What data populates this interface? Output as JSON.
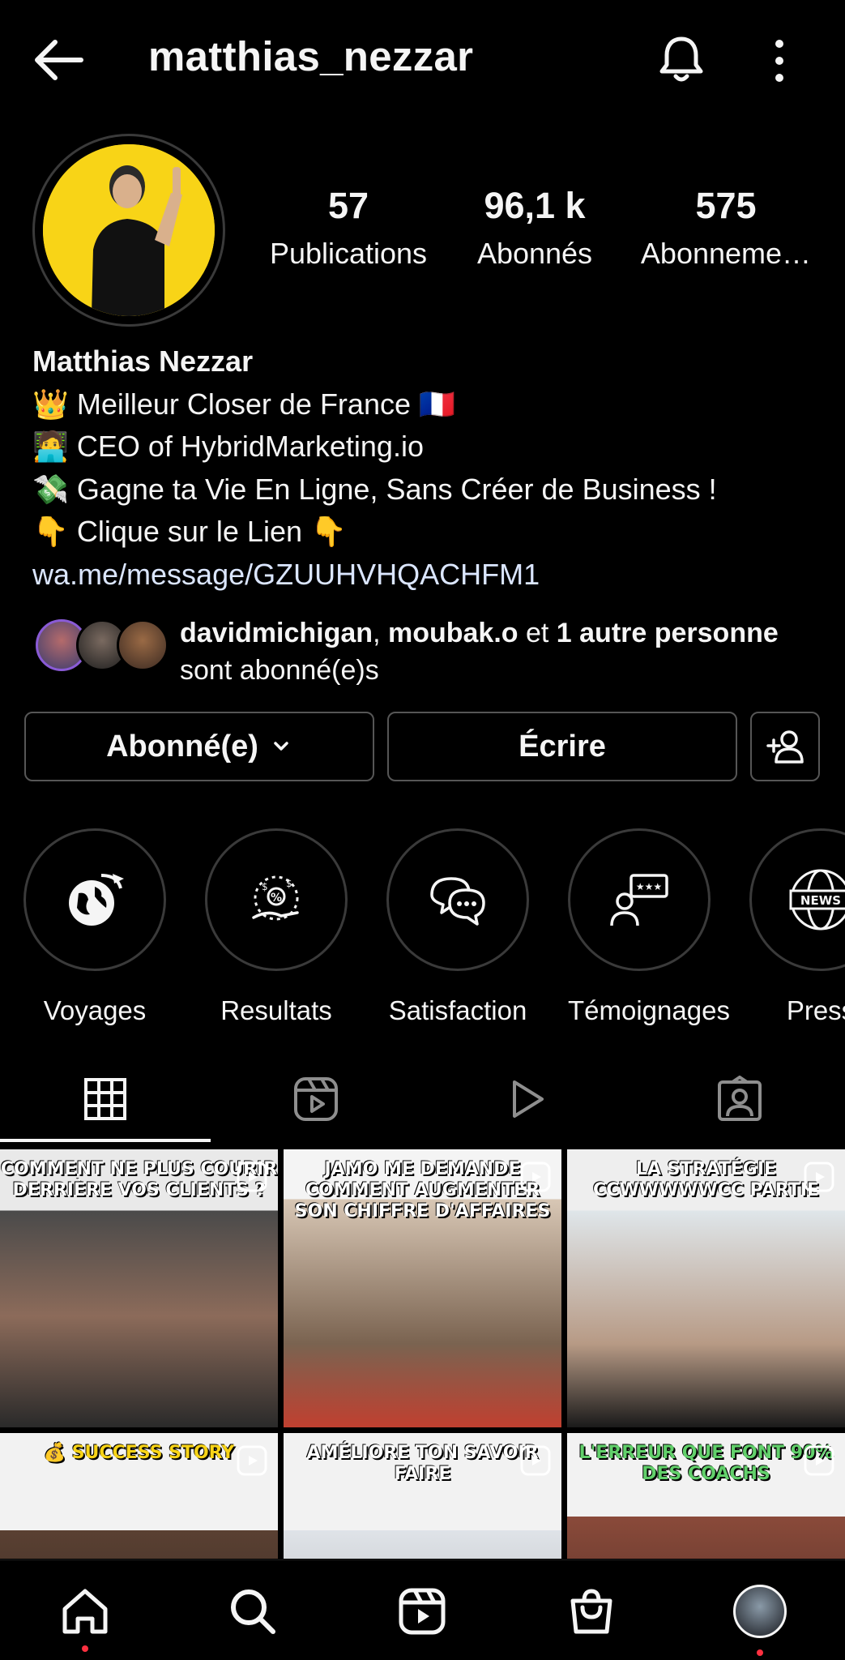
{
  "header": {
    "username": "matthias_nezzar"
  },
  "stats": [
    {
      "value": "57",
      "label": "Publications"
    },
    {
      "value": "96,1 k",
      "label": "Abonnés"
    },
    {
      "value": "575",
      "label": "Abonneme…"
    }
  ],
  "bio": {
    "name": "Matthias Nezzar",
    "lines": [
      "👑 Meilleur Closer de France 🇫🇷",
      "🧑‍💻 CEO of HybridMarketing.io",
      "💸 Gagne ta Vie En Ligne, Sans Créer de Business !",
      "👇 Clique sur le Lien 👇"
    ],
    "link": "wa.me/message/GZUUHVHQACHFM1"
  },
  "followed_by": {
    "user1": "davidmichigan",
    "sep": ", ",
    "user2": "moubak.o",
    "and": " et ",
    "others": "1 autre personne",
    "suffix": " sont abonné(e)s"
  },
  "buttons": {
    "follow": "Abonné(e)",
    "message": "Écrire"
  },
  "highlights": [
    {
      "label": "Voyages",
      "icon": "globe-plane-icon"
    },
    {
      "label": "Resultats",
      "icon": "money-hand-icon"
    },
    {
      "label": "Satisfaction",
      "icon": "chat-bubbles-icon"
    },
    {
      "label": "Témoignages",
      "icon": "testimonial-icon"
    },
    {
      "label": "Press",
      "icon": "news-globe-icon"
    }
  ],
  "posts": [
    {
      "caption": "COMMENT NE PLUS COURIR DERRIÈRE VOS CLIENTS ?"
    },
    {
      "caption": "JAMO ME DEMANDE COMMENT AUGMENTER SON CHIFFRE D'AFFAIRES"
    },
    {
      "caption": "LA STRATÉGIE CCWWWWWCC PARTIE"
    },
    {
      "caption": "💰 SUCCESS STORY"
    },
    {
      "caption": "AMÉLIORE TON SAVOIR FAIRE"
    },
    {
      "caption": "L'ERREUR QUE FONT 90% DES COACHS"
    }
  ],
  "colors": {
    "accent_yellow": "#f8d417",
    "notification_dot": "#ff3040",
    "border": "#565656"
  }
}
